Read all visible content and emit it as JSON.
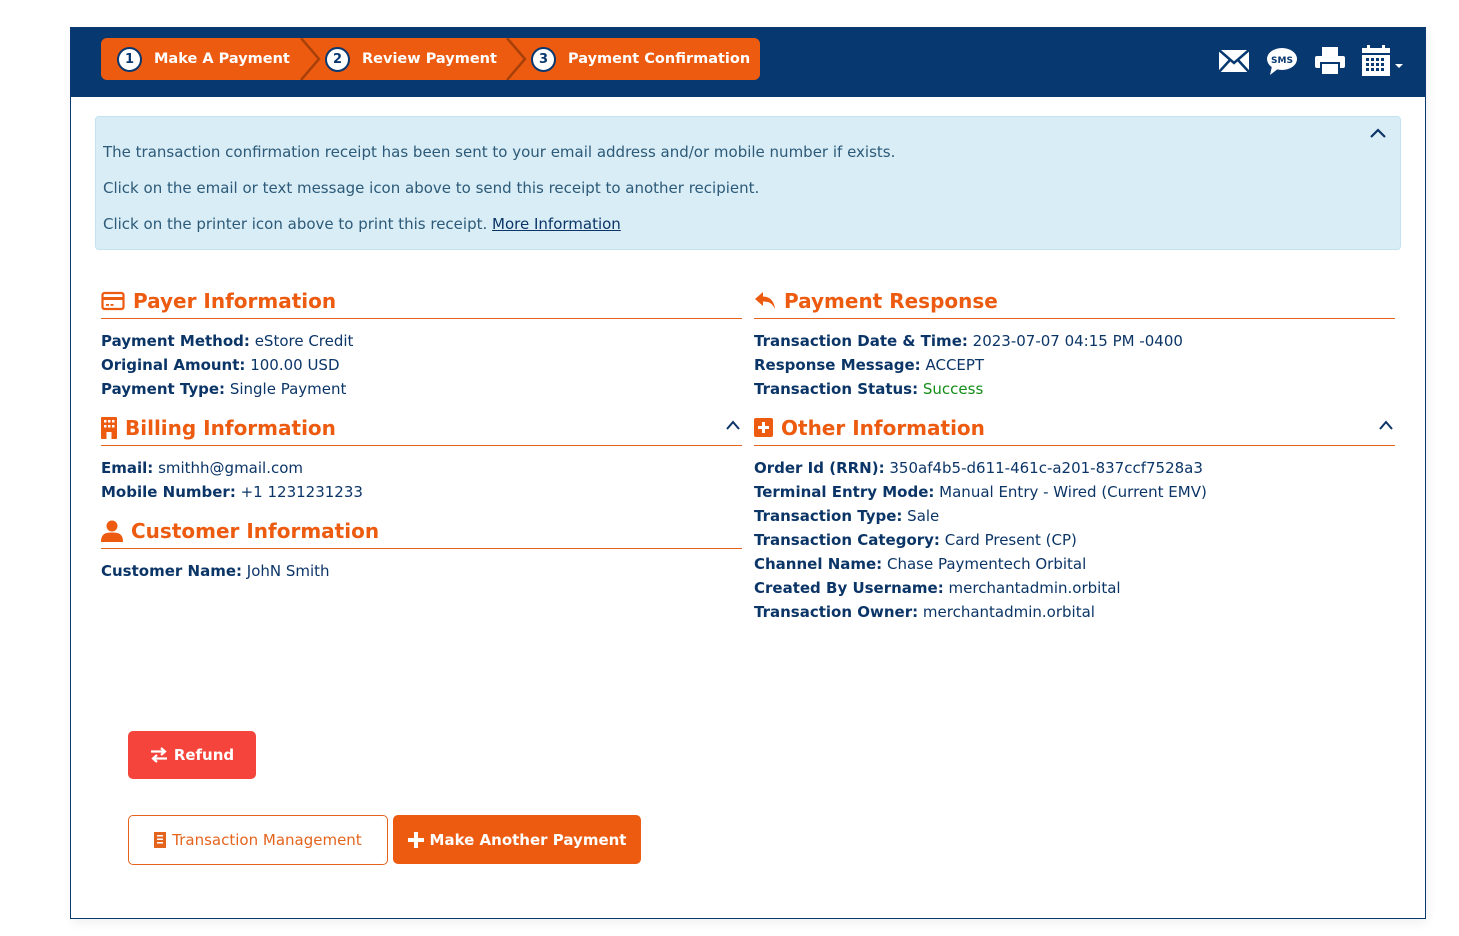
{
  "wizard": {
    "steps": [
      {
        "number": "1",
        "label": "Make A Payment"
      },
      {
        "number": "2",
        "label": "Review Payment"
      },
      {
        "number": "3",
        "label": "Payment Confirmation"
      }
    ]
  },
  "toolbar": {
    "icons": [
      "email-icon",
      "sms-icon",
      "printer-icon",
      "calendar-icon"
    ],
    "sms_text": "SMS"
  },
  "alert": {
    "line1": "The transaction confirmation receipt has been sent to your email address and/or mobile number if exists.",
    "line2": "Click on the email or text message icon above to send this receipt to another recipient.",
    "line3": "Click on the printer icon above to print this receipt.",
    "link": "More Information"
  },
  "payer": {
    "title": "Payer Information",
    "rows": [
      {
        "label": "Payment Method:",
        "value": "eStore Credit"
      },
      {
        "label": "Original Amount:",
        "value": "100.00 USD"
      },
      {
        "label": "Payment Type:",
        "value": "Single Payment"
      }
    ]
  },
  "billing": {
    "title": "Billing Information",
    "rows": [
      {
        "label": "Email:",
        "value": "smithh@gmail.com"
      },
      {
        "label": "Mobile Number:",
        "value": "+1 1231231233"
      }
    ]
  },
  "customer": {
    "title": "Customer Information",
    "rows": [
      {
        "label": "Customer Name:",
        "value": "JohN Smith"
      }
    ]
  },
  "response": {
    "title": "Payment Response",
    "rows": [
      {
        "label": "Transaction Date & Time:",
        "value": "2023-07-07 04:15 PM -0400"
      },
      {
        "label": "Response Message:",
        "value": "ACCEPT"
      },
      {
        "label": "Transaction Status:",
        "value": "Success"
      }
    ]
  },
  "other": {
    "title": "Other Information",
    "rows": [
      {
        "label": "Order Id (RRN):",
        "value": "350af4b5-d611-461c-a201-837ccf7528a3"
      },
      {
        "label": "Terminal Entry Mode:",
        "value": "Manual Entry - Wired (Current EMV)"
      },
      {
        "label": "Transaction Type:",
        "value": "Sale"
      },
      {
        "label": "Transaction Category:",
        "value": "Card Present (CP)"
      },
      {
        "label": "Channel Name:",
        "value": "Chase Paymentech Orbital"
      },
      {
        "label": "Created By Username:",
        "value": "merchantadmin.orbital"
      },
      {
        "label": "Transaction Owner:",
        "value": "merchantadmin.orbital"
      }
    ]
  },
  "buttons": {
    "refund": "Refund",
    "transaction_management": "Transaction Management",
    "make_another_payment": "Make Another Payment"
  },
  "colors": {
    "header_bg": "#083870",
    "accent_orange": "#ec5b10",
    "refund_red": "#f5443b",
    "success_green": "#138d17",
    "alert_bg": "#d9edf6"
  }
}
